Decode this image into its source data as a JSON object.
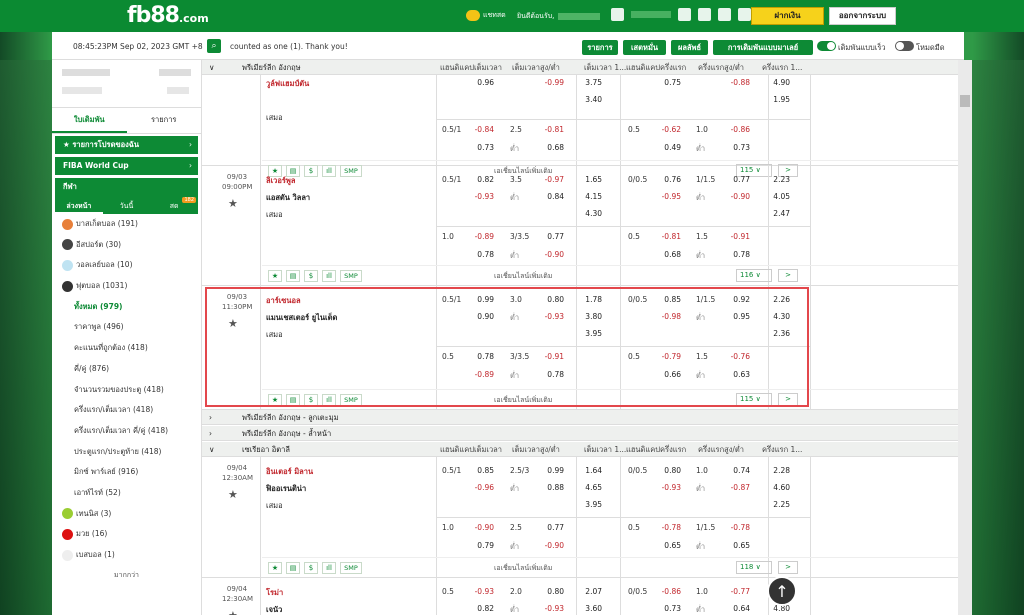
{
  "header": {
    "logo_main": "fb88",
    "logo_suffix": ".com",
    "chat_label": "แชทสด",
    "welcome_label": "ยินดีต้อนรับ,",
    "deposit_label": "ฝากเงิน",
    "logout_label": "ออกจากระบบ"
  },
  "subbar": {
    "datetime": "08:45:23PM Sep 02, 2023 GMT +8",
    "message": "counted as one (1). Thank you!",
    "btn_list": "รายการ",
    "btn_parlay": "เสตหมั่น",
    "btn_result": "ผลลัพธ์",
    "btn_settings": "การเดิมพันแบบมาเลย์",
    "toggle_fast": "เดิมพันแบบเร็ว",
    "toggle_dark": "โหมดมืด"
  },
  "sidebar": {
    "tab_slip": "ใบเดิมพัน",
    "tab_list": "รายการ",
    "fav_label": "รายการโปรดของฉัน",
    "fiba_label": "FIBA World Cup",
    "sports_label": "กีฬา",
    "sub_early": "ล่วงหน้า",
    "sub_today": "วันนี้",
    "sub_live": "สด",
    "live_badge": "182",
    "items": [
      {
        "label": "บาสเก็ตบอล (191)",
        "color": "#e8803a"
      },
      {
        "label": "อีสปอร์ต (30)",
        "color": "#444"
      },
      {
        "label": "วอลเลย์บอล (10)",
        "color": "#bfe3f2"
      },
      {
        "label": "ฟุตบอล (1031)",
        "color": "#333"
      }
    ],
    "soccer_sub": [
      "ทั้งหมด (979)",
      "ราคาพูล (496)",
      "คะแนนที่ถูกต้อง (418)",
      "คี่/คู่ (876)",
      "จำนวนรวมของประตู (418)",
      "ครึ่งแรก/เต็มเวลา (418)",
      "ครึ่งแรก/เต็มเวลา คี่/คู่ (418)",
      "ประตูแรก/ประตูท้าย (418)",
      "มิกซ์ พาร์เลย์ (916)",
      "เอาท์ไรท์ (52)"
    ],
    "items2": [
      {
        "label": "เทนนิส (3)",
        "color": "#9acd32"
      },
      {
        "label": "มวย (16)",
        "color": "#d11"
      },
      {
        "label": "เบสบอล (1)",
        "color": "#eee"
      }
    ],
    "more": "มากกว่า"
  },
  "columns": [
    "แฮนดิแคปเต็มเวลา",
    "เต็มเวลาสูง/ต่ำ",
    "เต็มเวลา 1...",
    "แฮนดิแคปครึ่งแรก",
    "ครึ่งแรกสูง/ต่ำ",
    "ครึ่งแรก 1..."
  ],
  "leagues": {
    "epl": "พรีเมียร์ลีก อังกฤษ",
    "epl_corners": "พรีเมียร์ลีก อังกฤษ - ลูกเตะมุม",
    "epl_bookings": "พรีเมียร์ลีก อังกฤษ - ล้ำหน้า",
    "seriea": "เซเรียอา อิตาลี"
  },
  "common": {
    "draw": "เสมอ",
    "low": "ต่ำ",
    "more_bets": "เอเชี่ยนไลน์เพิ่มเติม",
    "smp": "SMP",
    "next": ">"
  },
  "matches": [
    {
      "date": "",
      "time": "",
      "home": "วูล์ฟแฮมป์ตัน",
      "away": "",
      "r1": {
        "hdp": "",
        "h": "0.96",
        "ou": "",
        "o": "-0.99",
        "x1": "3.75",
        "fhdp": "",
        "fh": "0.75",
        "fou": "",
        "fo": "-0.88",
        "fx": "4.90"
      },
      "r2": {
        "h": "",
        "u": "",
        "x": "3.40",
        "fh": "",
        "fu": "",
        "fx": "1.95"
      },
      "alt1": {
        "hdp": "0.5/1",
        "h": "-0.84",
        "ou": "2.5",
        "o": "-0.81",
        "fhdp": "0.5",
        "fh": "-0.62",
        "fou": "1.0",
        "fo": "-0.86"
      },
      "alt2": {
        "a": "0.73",
        "u": "0.68",
        "fa": "0.49",
        "fu": "0.73"
      },
      "count": "115 ∨"
    },
    {
      "date": "09/03",
      "time": "09:00PM",
      "home": "ลิเวอร์พูล",
      "away": "แอสตัน วิลลา",
      "r1": {
        "hdp": "0.5/1",
        "h": "0.82",
        "ou": "3.5",
        "o": "-0.97",
        "x1": "1.65",
        "fhdp": "0/0.5",
        "fh": "0.76",
        "fou": "1/1.5",
        "fo": "0.77",
        "fx": "2.23"
      },
      "r2": {
        "h": "-0.93",
        "u": "0.84",
        "x": "4.15",
        "fh": "-0.95",
        "fu": "-0.90",
        "fx": "4.05"
      },
      "r3": {
        "x": "4.30",
        "fx": "2.47"
      },
      "alt1": {
        "hdp": "1.0",
        "h": "-0.89",
        "ou": "3/3.5",
        "o": "0.77",
        "fhdp": "0.5",
        "fh": "-0.81",
        "fou": "1.5",
        "fo": "-0.91"
      },
      "alt2": {
        "a": "0.78",
        "u": "-0.90",
        "fa": "0.68",
        "fu": "0.78"
      },
      "count": "116 ∨"
    },
    {
      "date": "09/03",
      "time": "11:30PM",
      "home": "อาร์เซนอล",
      "away": "แมนเชสเตอร์ ยูไนเต็ด",
      "r1": {
        "hdp": "0.5/1",
        "h": "0.99",
        "ou": "3.0",
        "o": "0.80",
        "x1": "1.78",
        "fhdp": "0/0.5",
        "fh": "0.85",
        "fou": "1/1.5",
        "fo": "0.92",
        "fx": "2.26"
      },
      "r2": {
        "h": "0.90",
        "u": "-0.93",
        "x": "3.80",
        "fh": "-0.98",
        "fu": "0.95",
        "fx": "4.30"
      },
      "r3": {
        "x": "3.95",
        "fx": "2.36"
      },
      "alt1": {
        "hdp": "0.5",
        "h": "0.78",
        "ou": "3/3.5",
        "o": "-0.91",
        "fhdp": "0.5",
        "fh": "-0.79",
        "fou": "1.5",
        "fo": "-0.76"
      },
      "alt2": {
        "a": "-0.89",
        "u": "0.78",
        "fa": "0.66",
        "fu": "0.63"
      },
      "count": "115 ∨"
    },
    {
      "date": "09/04",
      "time": "12:30AM",
      "home": "อินเตอร์ มิลาน",
      "away": "ฟิออเรนติน่า",
      "r1": {
        "hdp": "0.5/1",
        "h": "0.85",
        "ou": "2.5/3",
        "o": "0.99",
        "x1": "1.64",
        "fhdp": "0/0.5",
        "fh": "0.80",
        "fou": "1.0",
        "fo": "0.74",
        "fx": "2.28"
      },
      "r2": {
        "h": "-0.96",
        "u": "0.88",
        "x": "4.65",
        "fh": "-0.93",
        "fu": "-0.87",
        "fx": "4.60"
      },
      "r3": {
        "x": "3.95",
        "fx": "2.25"
      },
      "alt1": {
        "hdp": "1.0",
        "h": "-0.90",
        "ou": "2.5",
        "o": "0.77",
        "fhdp": "0.5",
        "fh": "-0.78",
        "fou": "1/1.5",
        "fo": "-0.78"
      },
      "alt2": {
        "a": "0.79",
        "u": "-0.90",
        "fa": "0.65",
        "fu": "0.65"
      },
      "count": "118 ∨"
    },
    {
      "date": "09/04",
      "time": "12:30AM",
      "home": "โรม่า",
      "away": "เจนัว",
      "r1": {
        "hdp": "0.5",
        "h": "-0.93",
        "ou": "2.0",
        "o": "0.80",
        "x1": "2.07",
        "fhdp": "0/0.5",
        "fh": "-0.86",
        "fou": "1.0",
        "fo": "-0.77",
        "fx": "1.94"
      },
      "r2": {
        "h": "0.82",
        "u": "-0.93",
        "x": "3.60",
        "fh": "0.73",
        "fu": "0.64",
        "fx": "4.80"
      }
    }
  ]
}
